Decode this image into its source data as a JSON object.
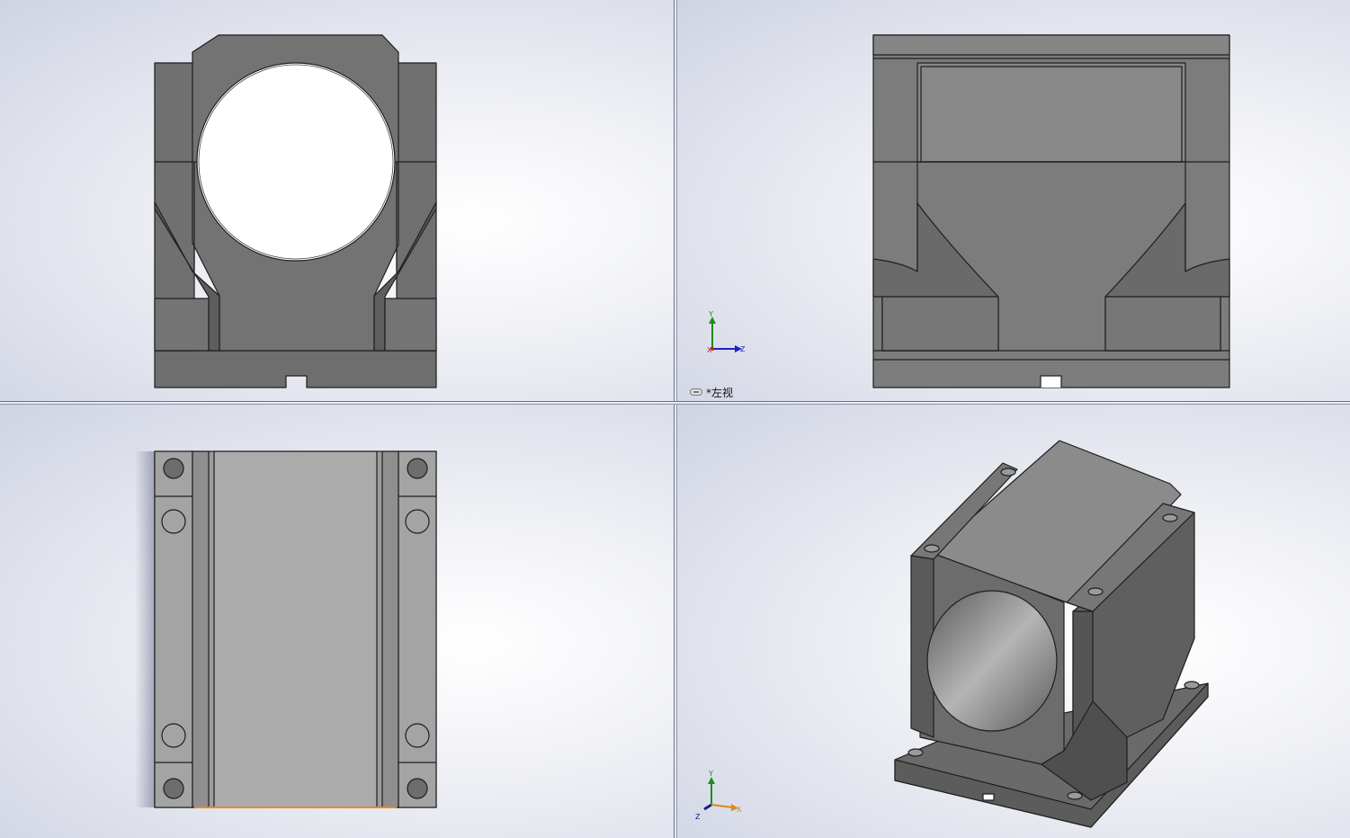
{
  "viewports": {
    "top_left": {
      "name": "front-view"
    },
    "top_right": {
      "name": "left-view",
      "label": "*左视",
      "triad": {
        "axes": [
          "Y",
          "X",
          "Z"
        ]
      }
    },
    "bottom_left": {
      "name": "top-view"
    },
    "bottom_right": {
      "name": "isometric-view",
      "triad": {
        "axes": [
          "Y",
          "Z",
          "X"
        ]
      }
    }
  },
  "colors": {
    "part_dark": "#696969",
    "part_mid": "#7b7b7b",
    "part_light": "#8a8a8a",
    "part_top": "#aaaaaa",
    "edge": "#1e1e1e",
    "triad_y": "#1f8a1f",
    "triad_z_left": "#2020c8",
    "triad_x_iso": "#d88a1a",
    "triad_z_iso": "#1a1a9a",
    "selection_edge": "#e58a2f"
  }
}
